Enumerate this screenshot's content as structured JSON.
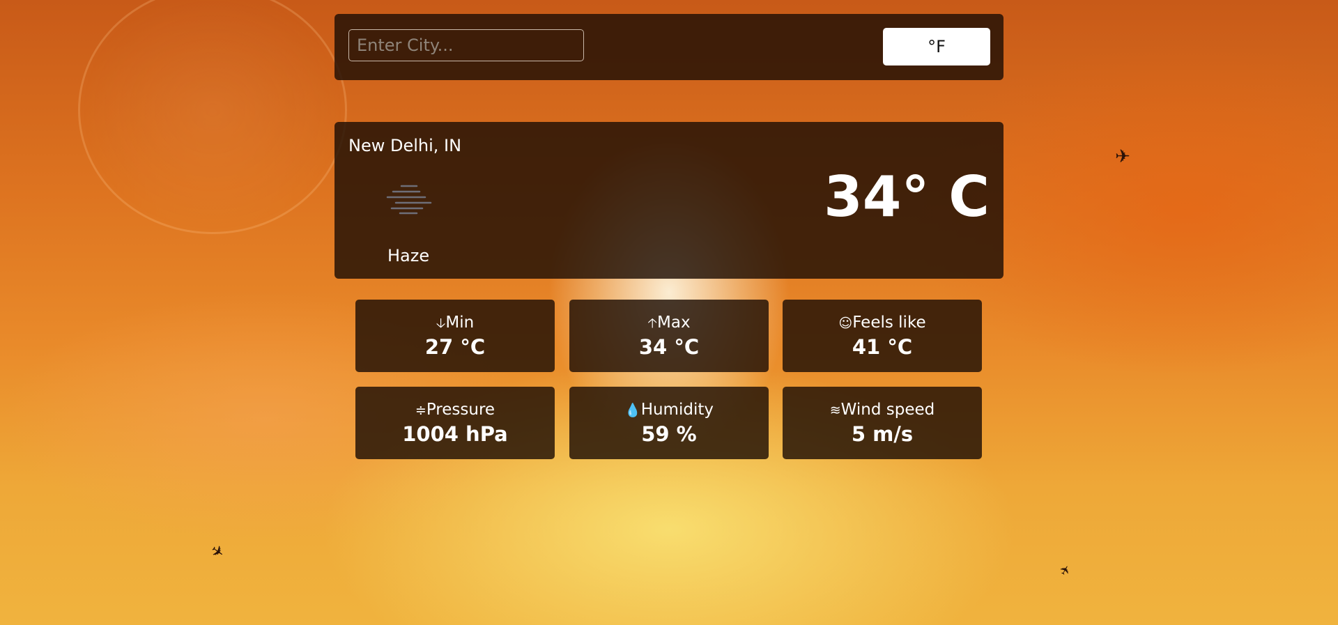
{
  "search": {
    "placeholder": "Enter City...",
    "unit_toggle_label": "°F"
  },
  "current": {
    "location": "New Delhi, IN",
    "icon": "haze-icon",
    "condition": "Haze",
    "temperature": "34° C"
  },
  "stats": [
    {
      "icon": "arrow-down-icon",
      "glyph": "🡣",
      "label": "Min",
      "value": "27 °C"
    },
    {
      "icon": "arrow-up-icon",
      "glyph": "🡡",
      "label": "Max",
      "value": "34 °C"
    },
    {
      "icon": "smiley-icon",
      "glyph": "☺",
      "label": "Feels like",
      "value": "41 °C"
    },
    {
      "icon": "pressure-icon",
      "glyph": "≑",
      "label": "Pressure",
      "value": "1004 hPa"
    },
    {
      "icon": "droplet-icon",
      "glyph": "💧",
      "label": "Humidity",
      "value": "59 %"
    },
    {
      "icon": "wind-icon",
      "glyph": "≋",
      "label": "Wind speed",
      "value": "5 m/s"
    }
  ],
  "colors": {
    "panel": "#1e0f05",
    "text": "#ffffff",
    "button": "#ffffff"
  }
}
